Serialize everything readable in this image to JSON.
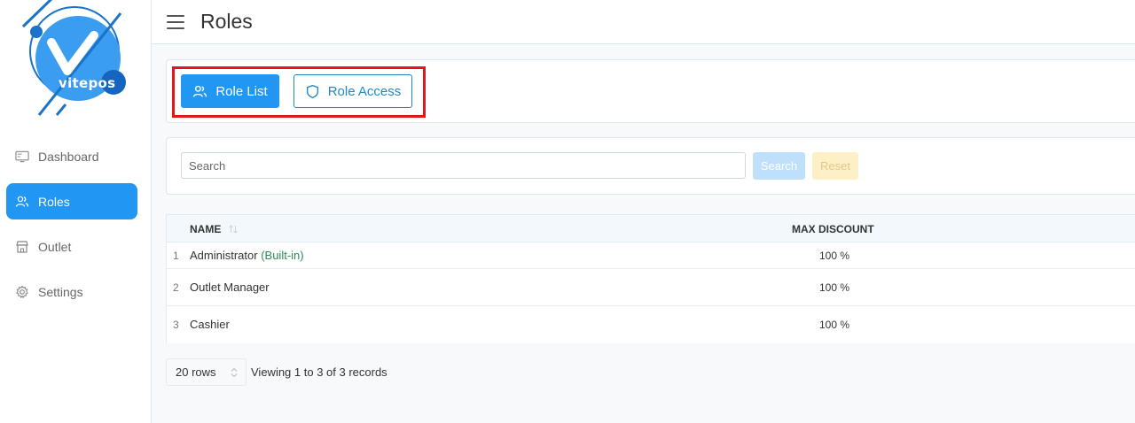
{
  "app": {
    "logo_text": "vitepos"
  },
  "sidebar": {
    "items": [
      {
        "label": "Dashboard",
        "icon": "monitor-icon",
        "active": false
      },
      {
        "label": "Roles",
        "icon": "users-icon",
        "active": true
      },
      {
        "label": "Outlet",
        "icon": "store-icon",
        "active": false
      },
      {
        "label": "Settings",
        "icon": "gear-icon",
        "active": false
      }
    ]
  },
  "header": {
    "title": "Roles",
    "menu_icon": "hamburger-icon"
  },
  "tabs": {
    "role_list": {
      "label": "Role List",
      "icon": "users-icon"
    },
    "role_access": {
      "label": "Role Access",
      "icon": "shield-icon"
    }
  },
  "search": {
    "placeholder": "Search",
    "value": "",
    "search_label": "Search",
    "reset_label": "Reset"
  },
  "table": {
    "columns": [
      "NAME",
      "MAX DISCOUNT"
    ],
    "rows": [
      {
        "num": "1",
        "name": "Administrator",
        "tag": "(Built-in)",
        "discount": "100 %"
      },
      {
        "num": "2",
        "name": "Outlet Manager",
        "tag": "",
        "discount": "100 %"
      },
      {
        "num": "3",
        "name": "Cashier",
        "tag": "",
        "discount": "100 %"
      }
    ]
  },
  "footer": {
    "rows_per_page": "20 rows",
    "viewing": "Viewing 1 to 3 of 3 records"
  },
  "colors": {
    "primary": "#2196f3",
    "builtin_tag": "#2e8b57",
    "highlight": "#e4161b"
  }
}
